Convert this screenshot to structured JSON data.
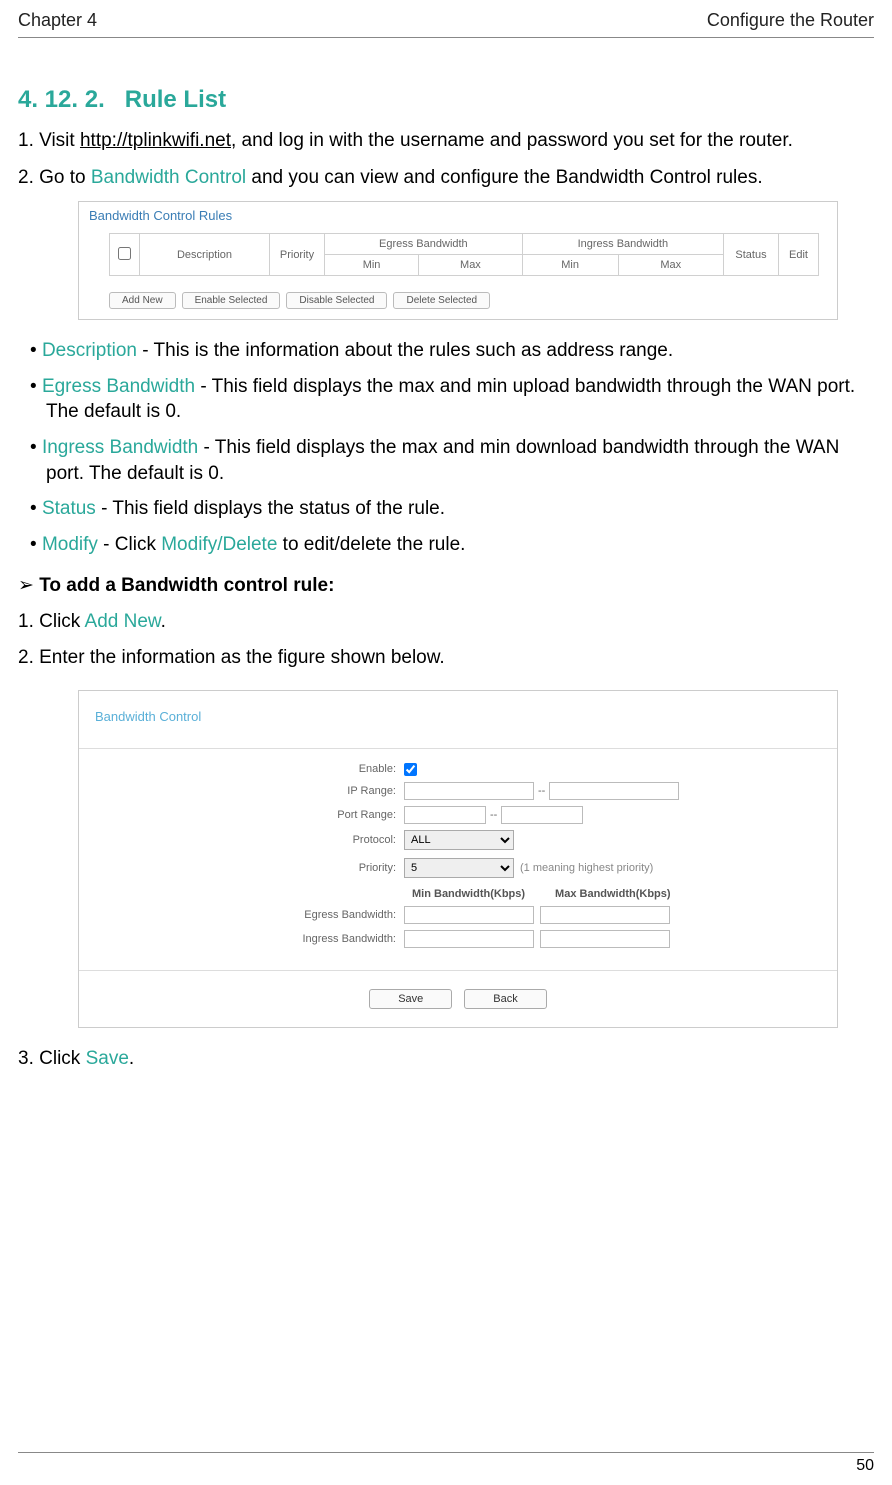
{
  "header": {
    "left": "Chapter 4",
    "right": "Configure the Router"
  },
  "section": {
    "number": "4. 12. 2.",
    "title": "Rule List"
  },
  "step1": {
    "prefix": "1. Visit ",
    "link": "http://tplinkwifi.net",
    "suffix": ", and log in with the username and password you set for the router."
  },
  "step2": {
    "prefix": "2. Go to ",
    "teal": "Bandwidth Control",
    "suffix": " and you can view and configure the Bandwidth Control rules."
  },
  "fig1": {
    "title": "Bandwidth Control Rules",
    "cols": {
      "desc": "Description",
      "priority": "Priority",
      "egress": "Egress Bandwidth",
      "ingress": "Ingress Bandwidth",
      "min": "Min",
      "max": "Max",
      "status": "Status",
      "edit": "Edit"
    },
    "btns": [
      "Add New",
      "Enable Selected",
      "Disable Selected",
      "Delete Selected"
    ]
  },
  "bullets": [
    {
      "term": "Description",
      "rest": " - This is the information about the rules such as address range."
    },
    {
      "term": "Egress Bandwidth",
      "rest": " - This field displays the max and min upload bandwidth through the WAN port. The default is 0."
    },
    {
      "term": "Ingress Bandwidth",
      "rest": " - This field displays the max and min download bandwidth through the WAN port. The default is 0."
    },
    {
      "term": "Status",
      "rest": " - This field displays the status of the rule."
    },
    {
      "term": "Modify",
      "restPrefix": " - Click ",
      "teal2": "Modify/Delete",
      "restSuffix": " to edit/delete the rule."
    }
  ],
  "arrow": "To add a Bandwidth control rule:",
  "add1": {
    "prefix": "1. Click ",
    "teal": "Add New",
    "suffix": "."
  },
  "add2": "2. Enter the information as the figure shown below.",
  "fig2": {
    "title": "Bandwidth Control",
    "labels": {
      "enable": "Enable:",
      "ipRange": "IP Range:",
      "portRange": "Port Range:",
      "protocol": "Protocol:",
      "priority": "Priority:",
      "egress": "Egress Bandwidth:",
      "ingress": "Ingress Bandwidth:"
    },
    "protocolValue": "ALL",
    "priorityValue": "5",
    "priorityHint": "(1 meaning highest priority)",
    "colMin": "Min Bandwidth(Kbps)",
    "colMax": "Max Bandwidth(Kbps)",
    "save": "Save",
    "back": "Back"
  },
  "step3": {
    "prefix": "3. Click ",
    "teal": "Save",
    "suffix": "."
  },
  "pageNumber": "50"
}
